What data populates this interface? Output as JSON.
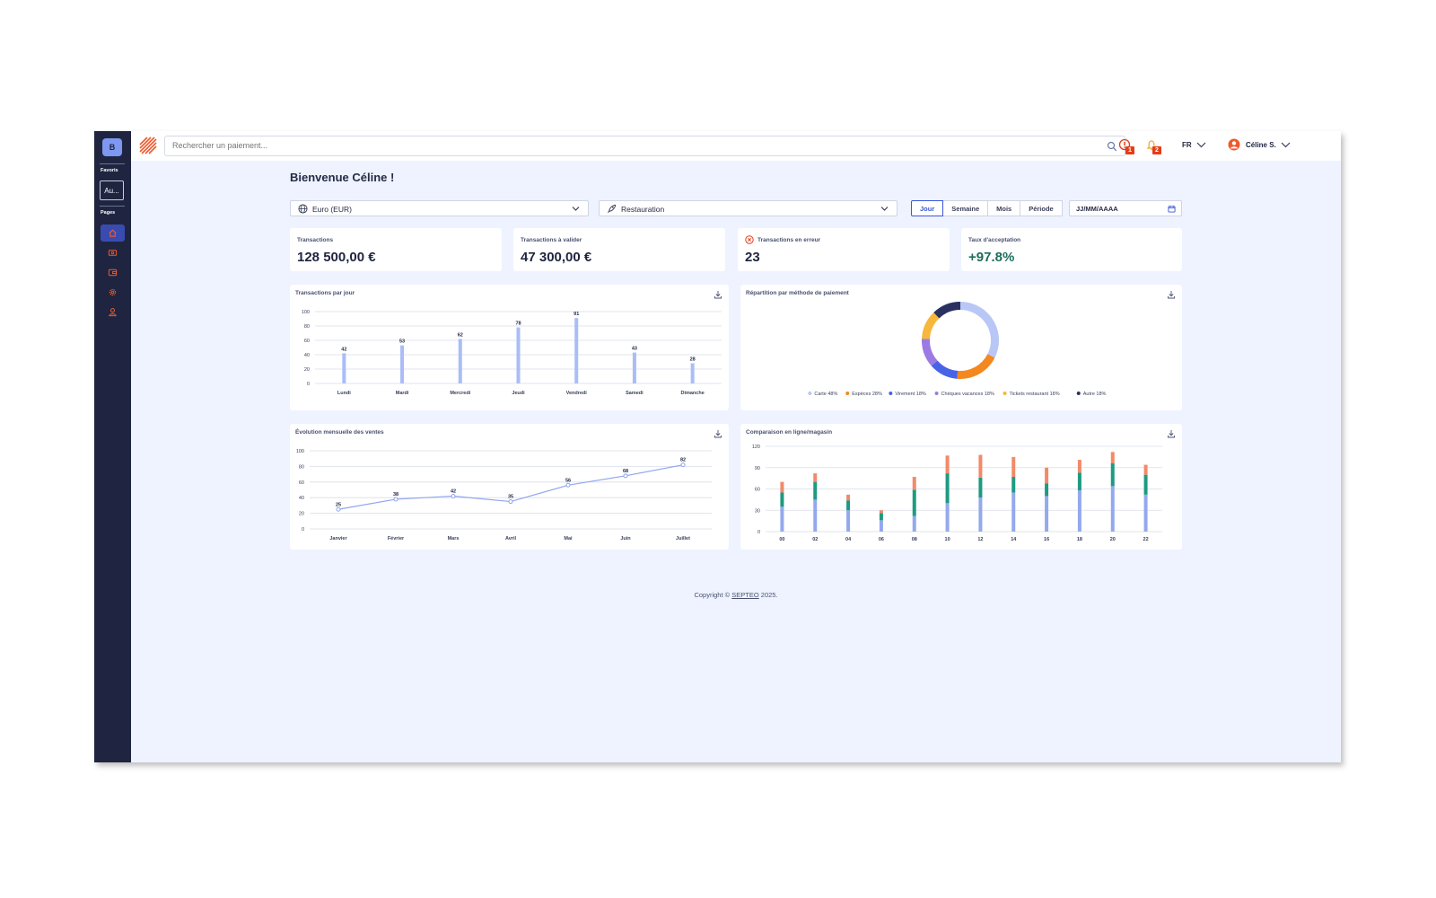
{
  "sidebar": {
    "avatar": "B",
    "favorites_label": "Favoris",
    "favorite_item": "Au...",
    "pages_label": "Pages",
    "nav": [
      {
        "icon": "home-icon",
        "active": true
      },
      {
        "icon": "payments-icon",
        "active": false
      },
      {
        "icon": "wallet-icon",
        "active": false
      },
      {
        "icon": "settings-icon",
        "active": false
      },
      {
        "icon": "user-icon",
        "active": false
      }
    ]
  },
  "topbar": {
    "search_placeholder": "Rechercher un paiement...",
    "alerts_count": "1",
    "notifications_count": "2",
    "language": "FR",
    "user_name": "Céline S."
  },
  "main": {
    "welcome": "Bienvenue Céline !",
    "currency": "Euro (EUR)",
    "activity": "Restauration",
    "periods": [
      "Jour",
      "Semaine",
      "Mois",
      "Période"
    ],
    "active_period": "Jour",
    "date_placeholder": "JJ/MM/AAAA",
    "kpis": [
      {
        "label": "Transactions",
        "value": "128 500,00 €"
      },
      {
        "label": "Transactions à valider",
        "value": "47 300,00 €"
      },
      {
        "label": "Transactions en erreur",
        "value": "23"
      },
      {
        "label": "Taux d'acceptation",
        "value": "+97.8%"
      }
    ],
    "chart_titles": {
      "daily": "Transactions par jour",
      "payment": "Répartition par méthode de paiement",
      "monthly": "Évolution mensuelle des ventes",
      "compare": "Comparaison en ligne/magasin"
    }
  },
  "footer": {
    "prefix": "Copyright © ",
    "brand": "SEPTEO",
    "suffix": " 2025."
  },
  "colors": {
    "bar": "#a9bdf6",
    "line": "#8ea4ef",
    "sidebar": "#1f2540",
    "accent": "#3b56d9",
    "brand": "#ee5a2c"
  },
  "chart_data": [
    {
      "type": "bar",
      "title": "Transactions par jour",
      "categories": [
        "Lundi",
        "Mardi",
        "Mercredi",
        "Jeudi",
        "Vendredi",
        "Samedi",
        "Dimanche"
      ],
      "values": [
        42,
        53,
        62,
        78,
        91,
        43,
        28
      ],
      "ylim": [
        0,
        100
      ],
      "yticks": [
        0,
        20,
        40,
        60,
        80,
        100
      ],
      "grid": true
    },
    {
      "type": "pie",
      "title": "Répartition par méthode de paiement",
      "donut": true,
      "legend_position": "bottom",
      "series": [
        {
          "name": "Carte 48%",
          "value": 48,
          "color": "#b9c7f7"
        },
        {
          "name": "Espèces 28%",
          "value": 28,
          "color": "#f5871f"
        },
        {
          "name": "Virement 18%",
          "value": 18,
          "color": "#4763e6"
        },
        {
          "name": "Chèques vacances 18%",
          "value": 18,
          "color": "#9b7be3"
        },
        {
          "name": "Tickets restaurant 18%",
          "value": 18,
          "color": "#f6b73c"
        },
        {
          "name": "Autre 18%",
          "value": 18,
          "color": "#2a3160"
        }
      ]
    },
    {
      "type": "line",
      "title": "Évolution mensuelle des ventes",
      "categories": [
        "Janvier",
        "Février",
        "Mars",
        "Avril",
        "Mai",
        "Juin",
        "Juillet"
      ],
      "values": [
        25,
        38,
        42,
        35,
        56,
        68,
        82
      ],
      "ylim": [
        0,
        100
      ],
      "yticks": [
        0,
        20,
        40,
        60,
        80,
        100
      ],
      "grid": true
    },
    {
      "type": "bar",
      "stacked": true,
      "title": "Comparaison en ligne/magasin",
      "categories": [
        "00",
        "02",
        "04",
        "06",
        "08",
        "10",
        "12",
        "14",
        "16",
        "18",
        "20",
        "22"
      ],
      "series": [
        {
          "color": "#93a9ee",
          "values": [
            35,
            45,
            30,
            16,
            22,
            40,
            48,
            55,
            50,
            58,
            64,
            52
          ]
        },
        {
          "color": "#1f9a82",
          "values": [
            20,
            25,
            14,
            10,
            37,
            42,
            28,
            22,
            18,
            25,
            32,
            28
          ]
        },
        {
          "color": "#f28a6a",
          "values": [
            15,
            12,
            8,
            4,
            18,
            25,
            32,
            28,
            22,
            18,
            16,
            14
          ]
        }
      ],
      "ylim": [
        0,
        120
      ],
      "yticks": [
        0,
        30,
        60,
        90,
        120
      ],
      "grid": true
    }
  ]
}
